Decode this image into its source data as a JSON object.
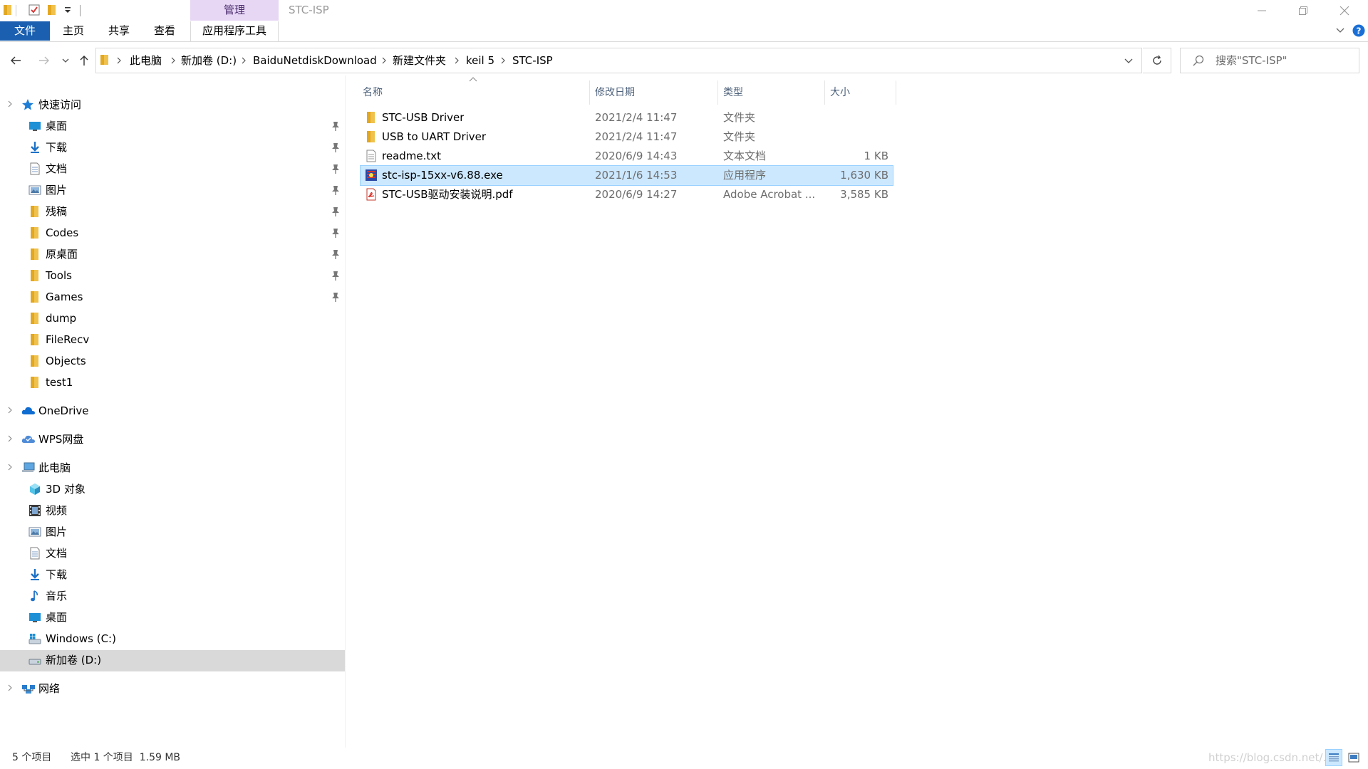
{
  "window": {
    "title": "STC-ISP",
    "context_tab": "管理"
  },
  "ribbon": {
    "tabs": [
      "文件",
      "主页",
      "共享",
      "查看",
      "应用程序工具"
    ]
  },
  "address": {
    "crumbs": [
      "此电脑",
      "新加卷 (D:)",
      "BaiduNetdiskDownload",
      "新建文件夹",
      "keil 5",
      "STC-ISP"
    ]
  },
  "search": {
    "placeholder": "搜索\"STC-ISP\""
  },
  "nav": {
    "quick_access": "快速访问",
    "quick_items": [
      {
        "label": "桌面",
        "icon": "desktop-icon",
        "pinned": true
      },
      {
        "label": "下载",
        "icon": "download-icon",
        "pinned": true
      },
      {
        "label": "文档",
        "icon": "document-icon",
        "pinned": true
      },
      {
        "label": "图片",
        "icon": "pictures-icon",
        "pinned": true
      },
      {
        "label": "残稿",
        "icon": "folder-icon",
        "pinned": true
      },
      {
        "label": "Codes",
        "icon": "folder-icon",
        "pinned": true
      },
      {
        "label": "原桌面",
        "icon": "folder-icon",
        "pinned": true
      },
      {
        "label": "Tools",
        "icon": "folder-icon",
        "pinned": true
      },
      {
        "label": "Games",
        "icon": "folder-icon",
        "pinned": true
      },
      {
        "label": "dump",
        "icon": "folder-icon",
        "pinned": false
      },
      {
        "label": "FileRecv",
        "icon": "folder-icon",
        "pinned": false
      },
      {
        "label": "Objects",
        "icon": "folder-icon",
        "pinned": false
      },
      {
        "label": "test1",
        "icon": "folder-icon",
        "pinned": false
      }
    ],
    "onedrive": "OneDrive",
    "wps": "WPS网盘",
    "this_pc": "此电脑",
    "pc_items": [
      {
        "label": "3D 对象",
        "icon": "3d-objects-icon"
      },
      {
        "label": "视频",
        "icon": "video-icon"
      },
      {
        "label": "图片",
        "icon": "pictures-icon"
      },
      {
        "label": "文档",
        "icon": "document-icon"
      },
      {
        "label": "下载",
        "icon": "download-icon"
      },
      {
        "label": "音乐",
        "icon": "music-icon"
      },
      {
        "label": "桌面",
        "icon": "desktop-icon"
      },
      {
        "label": "Windows (C:)",
        "icon": "drive-c-icon"
      },
      {
        "label": "新加卷 (D:)",
        "icon": "drive-icon",
        "selected": true
      }
    ],
    "network": "网络"
  },
  "columns": {
    "name": "名称",
    "date": "修改日期",
    "type": "类型",
    "size": "大小"
  },
  "files": [
    {
      "name": "STC-USB Driver",
      "date": "2021/2/4 11:47",
      "type": "文件夹",
      "size": "",
      "icon": "folder-icon"
    },
    {
      "name": "USB to UART Driver",
      "date": "2021/2/4 11:47",
      "type": "文件夹",
      "size": "",
      "icon": "folder-icon"
    },
    {
      "name": "readme.txt",
      "date": "2020/6/9 14:43",
      "type": "文本文档",
      "size": "1 KB",
      "icon": "text-file-icon"
    },
    {
      "name": "stc-isp-15xx-v6.88.exe",
      "date": "2021/1/6 14:53",
      "type": "应用程序",
      "size": "1,630 KB",
      "icon": "exe-icon",
      "selected": true
    },
    {
      "name": "STC-USB驱动安装说明.pdf",
      "date": "2020/6/9 14:27",
      "type": "Adobe Acrobat ...",
      "size": "3,585 KB",
      "icon": "pdf-icon"
    }
  ],
  "status": {
    "item_count": "5 个项目",
    "selection": "选中 1 个项目  1.59 MB",
    "watermark": "https://blog.csdn.net/..."
  },
  "colors": {
    "accent": "#1a5fb0",
    "context_tab": "#e7d7f5",
    "selection": "#cce8ff",
    "folder": "#f0c14b"
  }
}
